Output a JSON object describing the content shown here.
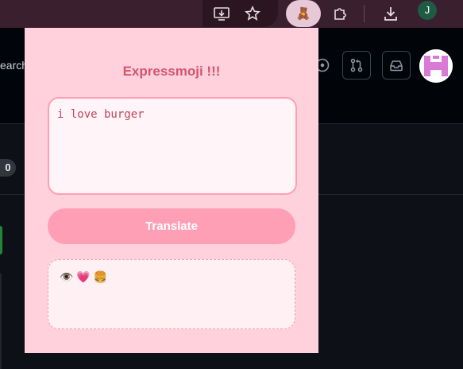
{
  "browser": {
    "profile_initial": "J",
    "extension_icon": "🧸",
    "icons": [
      "install-icon",
      "star-icon",
      "puzzle-icon",
      "download-icon"
    ]
  },
  "github": {
    "search_fragment": "earch",
    "counter": "0"
  },
  "popup": {
    "title": "Expressmoji !!!",
    "input_value": "i love burger",
    "translate_label": "Translate",
    "output": "👁️💗🍔"
  },
  "colors": {
    "popup_bg": "#ffd1dc",
    "accent": "#ff9fb5",
    "title": "#d4546e",
    "browser_toolbar": "#3a1f2e"
  }
}
